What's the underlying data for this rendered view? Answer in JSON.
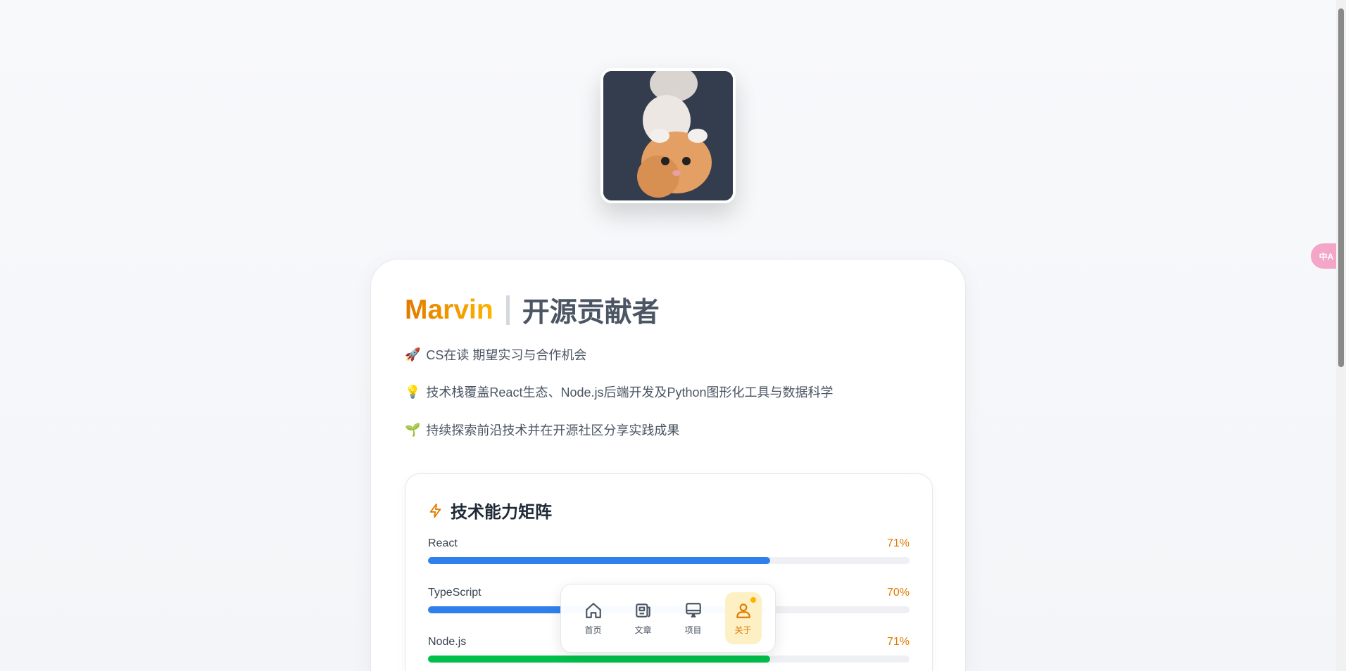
{
  "profile": {
    "name": "Marvin",
    "role": "开源贡献者",
    "lines": [
      {
        "icon": "rocket-icon",
        "emoji": "🚀",
        "text": "CS在读 期望实习与合作机会"
      },
      {
        "icon": "lightbulb-icon",
        "emoji": "💡",
        "text": "技术栈覆盖React生态、Node.js后端开发及Python图形化工具与数据科学"
      },
      {
        "icon": "seedling-icon",
        "emoji": "🌱",
        "text": "持续探索前沿技术并在开源社区分享实践成果"
      }
    ]
  },
  "skills": {
    "title": "技术能力矩阵",
    "icon": "lightning-icon",
    "items": [
      {
        "label": "React",
        "percent_text": "71%",
        "value": 71,
        "color": "#2f80ed"
      },
      {
        "label": "TypeScript",
        "percent_text": "70%",
        "value": 70,
        "color": "#2f80ed"
      },
      {
        "label": "Node.js",
        "percent_text": "71%",
        "value": 71,
        "color": "#00c04b"
      }
    ]
  },
  "nav": {
    "items": [
      {
        "label": "首页",
        "icon": "home-icon",
        "active": false
      },
      {
        "label": "文章",
        "icon": "newspaper-icon",
        "active": false
      },
      {
        "label": "项目",
        "icon": "monitor-icon",
        "active": false
      },
      {
        "label": "关于",
        "icon": "user-icon",
        "active": true
      }
    ]
  },
  "translate": {
    "label": "中A",
    "icon": "translate-icon"
  },
  "colors": {
    "accent": "#e07a00",
    "accent_light": "#ffb300",
    "active_bg": "#fdf0c5"
  }
}
